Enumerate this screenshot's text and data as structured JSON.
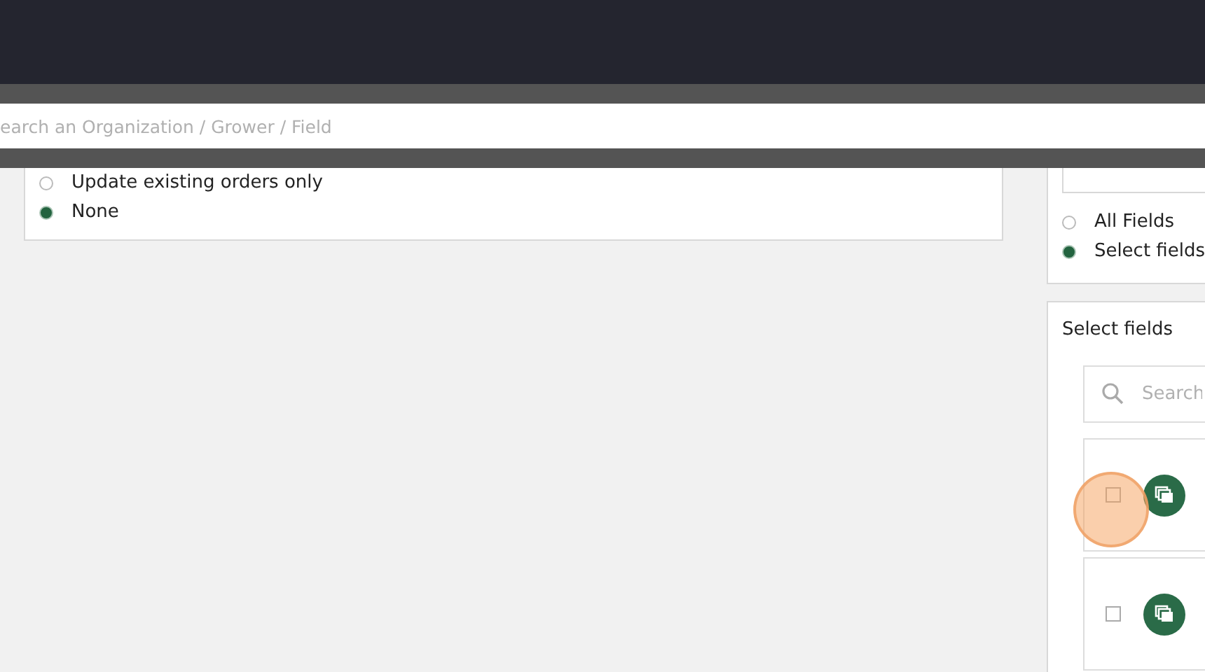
{
  "search": {
    "placeholder": "earch an Organization / Grower / Field"
  },
  "order_options": [
    {
      "label": "Update existing orders only",
      "selected": false
    },
    {
      "label": "None",
      "selected": true
    }
  ],
  "field_scope": [
    {
      "label": "All Fields",
      "selected": false
    },
    {
      "label": "Select fields",
      "selected": true
    }
  ],
  "select_fields": {
    "title": "Select fields",
    "search_placeholder": "Search",
    "items": [
      {
        "checked": false,
        "highlighted": true
      },
      {
        "checked": false,
        "highlighted": false
      }
    ]
  }
}
